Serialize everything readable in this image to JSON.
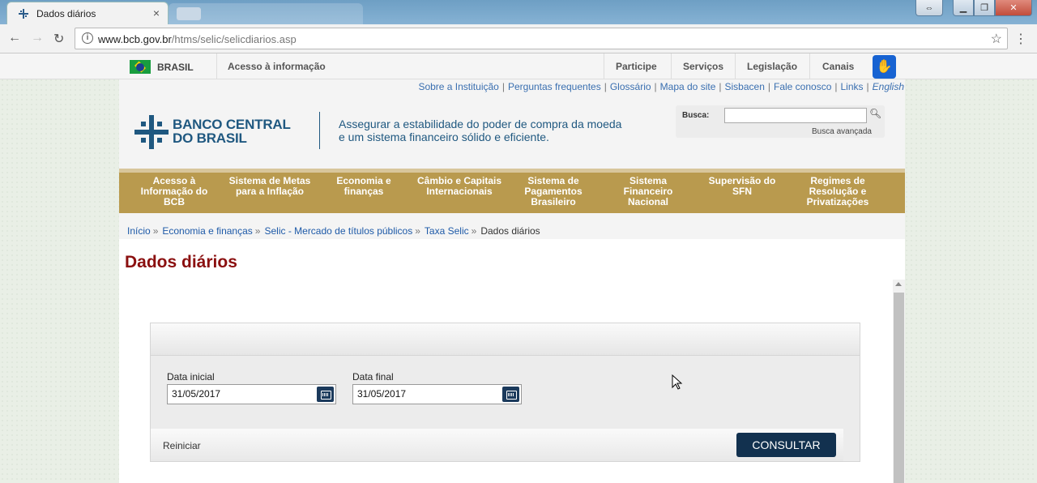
{
  "browser": {
    "tab_title": "Dados diários",
    "tab_close": "×",
    "url_host": "www.bcb.gov.br",
    "url_path": "/htms/selic/selicdiarios.asp"
  },
  "gov_bar": {
    "brasil": "BRASIL",
    "acesso": "Acesso à informação",
    "items": [
      "Participe",
      "Serviços",
      "Legislação",
      "Canais"
    ]
  },
  "top_links": [
    "Sobre a Instituição",
    "Perguntas frequentes",
    "Glossário",
    "Mapa do site",
    "Sisbacen",
    "Fale conosco",
    "Links",
    "English"
  ],
  "header": {
    "logo_line1": "BANCO CENTRAL",
    "logo_line2": "DO BRASIL",
    "slogan_line1": "Assegurar a estabilidade do poder de compra da moeda",
    "slogan_line2": "e um sistema financeiro sólido e eficiente.",
    "search_label": "Busca:",
    "search_value": "",
    "advanced_search": "Busca avançada"
  },
  "menu": [
    {
      "line1": "Acesso à",
      "line2": "Informação do",
      "line3": "BCB"
    },
    {
      "line1": "Sistema de Metas",
      "line2": "para a Inflação",
      "line3": ""
    },
    {
      "line1": "Economia e",
      "line2": "finanças",
      "line3": ""
    },
    {
      "line1": "Câmbio e Capitais",
      "line2": "Internacionais",
      "line3": ""
    },
    {
      "line1": "Sistema de",
      "line2": "Pagamentos",
      "line3": "Brasileiro"
    },
    {
      "line1": "Sistema",
      "line2": "Financeiro",
      "line3": "Nacional"
    },
    {
      "line1": "Supervisão do",
      "line2": "SFN",
      "line3": ""
    },
    {
      "line1": "Regimes de",
      "line2": "Resolução e",
      "line3": "Privatizações"
    }
  ],
  "breadcrumb": {
    "links": [
      "Início",
      "Economia e finanças",
      "Selic - Mercado de títulos públicos",
      "Taxa Selic"
    ],
    "current": "Dados diários",
    "separator": "»"
  },
  "page_title": "Dados diários",
  "form": {
    "start_label": "Data inicial",
    "start_value": "31/05/2017",
    "end_label": "Data final",
    "end_value": "31/05/2017",
    "reset_label": "Reiniciar",
    "submit_label": "CONSULTAR"
  },
  "colors": {
    "menu_gold": "#b99a4e",
    "brand_blue": "#1f5880",
    "title_red": "#8b1010",
    "button_navy": "#12314f"
  }
}
